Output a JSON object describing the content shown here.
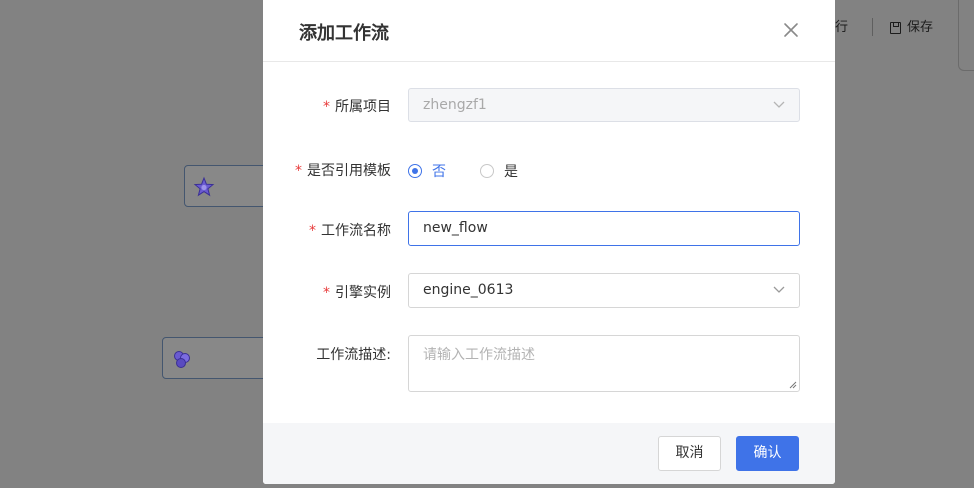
{
  "toolbar": {
    "run_label": "行",
    "save_label": "保存",
    "save_icon": "save-icon"
  },
  "dialog": {
    "title": "添加工作流",
    "close_icon": "close-icon",
    "required_mark": "*",
    "fields": {
      "project": {
        "label": "所属项目",
        "value": "zhengzf1",
        "disabled": true
      },
      "use_template": {
        "label": "是否引用模板",
        "options": [
          "否",
          "是"
        ],
        "selected": "否"
      },
      "name": {
        "label": "工作流名称",
        "value": "new_flow"
      },
      "engine": {
        "label": "引擎实例",
        "value": "engine_0613"
      },
      "description": {
        "label": "工作流描述:",
        "placeholder": "请输入工作流描述"
      }
    },
    "footer": {
      "cancel_label": "取消",
      "confirm_label": "确认"
    }
  },
  "colors": {
    "primary": "#3f73e8",
    "required": "#e83a3a",
    "overlay": "#828282"
  }
}
